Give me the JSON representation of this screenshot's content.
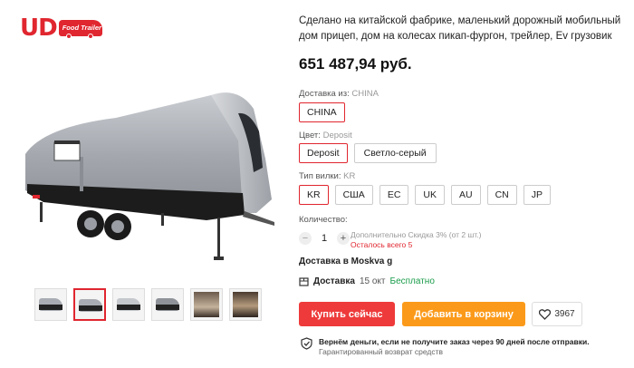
{
  "brand": {
    "logo_text": "UD",
    "logo_sub": "Food Trailer"
  },
  "gallery": {
    "thumbnails": [
      "trailer-front",
      "trailer-side-selected",
      "trailer-rear",
      "trailer-angle",
      "interior-1",
      "interior-2"
    ],
    "selected_index": 1
  },
  "product": {
    "title": "Сделано на китайской фабрике, маленький дорожный мобильный дом прицеп, дом на колесах пикап-фургон, трейлер, Ev грузовик",
    "price": "651 487,94 руб."
  },
  "shipping_from": {
    "label": "Доставка из:",
    "value": "CHINA",
    "options": [
      "CHINA"
    ]
  },
  "color": {
    "label": "Цвет:",
    "value": "Deposit",
    "options": [
      "Deposit",
      "Светло-серый"
    ]
  },
  "plug": {
    "label": "Тип вилки:",
    "value": "KR",
    "options": [
      "KR",
      "США",
      "EC",
      "UK",
      "AU",
      "CN",
      "JP"
    ]
  },
  "quantity": {
    "label": "Количество:",
    "value": "1",
    "minus": "−",
    "plus": "+",
    "discount_note": "Дополнительно Скидка 3% (от 2 шт.)",
    "stock_note": "Осталось всего 5"
  },
  "ship_to": "Доставка в Moskva g",
  "delivery": {
    "label": "Доставка",
    "date": "15 окт",
    "price": "Бесплатно"
  },
  "actions": {
    "buy_now": "Купить сейчас",
    "add_to_cart": "Добавить в корзину",
    "wishlist_count": "3967"
  },
  "guarantee": {
    "line1": "Вернём деньги, если не получите заказ через 90 дней после отправки.",
    "line2": "Гарантированный возврат средств"
  },
  "colors": {
    "accent_red": "#e0262f",
    "buy_red": "#ee3a3a",
    "cart_orange": "#fb9a1a",
    "free_green": "#1a9c4a"
  }
}
